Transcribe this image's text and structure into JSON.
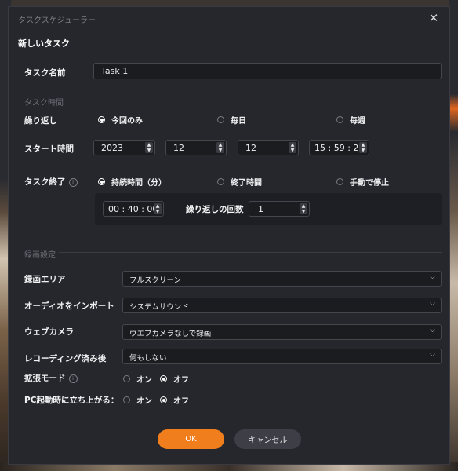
{
  "dialog": {
    "title": "タスクスケジューラー",
    "heading": "新しいタスク",
    "close_icon": "close-icon"
  },
  "task_name": {
    "label": "タスク名前",
    "value": "Task 1"
  },
  "task_time": {
    "section_title": "タスク時間",
    "repeat": {
      "label": "繰り返し",
      "options": [
        "今回のみ",
        "毎日",
        "毎週"
      ],
      "selected": "今回のみ"
    },
    "start": {
      "label": "スタート時間",
      "year": "2023",
      "month": "12",
      "day": "12",
      "time": "15 : 59 : 28"
    },
    "end": {
      "label": "タスク終了",
      "info_icon": "info-icon",
      "options": [
        "持続時間（分）",
        "終了時間",
        "手動で停止"
      ],
      "selected": "持続時間（分）",
      "duration": "00 : 40 : 00",
      "repeat_count_label": "繰り返しの回数",
      "repeat_count": "1"
    }
  },
  "recording": {
    "section_title": "録画設定",
    "area": {
      "label": "録画エリア",
      "value": "フルスクリーン"
    },
    "audio": {
      "label": "オーディオをインポート",
      "value": "システムサウンド"
    },
    "webcam": {
      "label": "ウェブカメラ",
      "value": "ウエブカメラなしで録画"
    },
    "after": {
      "label": "レコーディング済み後",
      "value": "何もしない"
    },
    "extended": {
      "label": "拡張モード",
      "info_icon": "info-icon",
      "on": "オン",
      "off": "オフ",
      "selected": "オフ"
    },
    "startup": {
      "label": "PC起動時に立ち上がる：",
      "on": "オン",
      "off": "オフ",
      "selected": "オフ"
    }
  },
  "buttons": {
    "ok": "OK",
    "cancel": "キャンセル"
  },
  "colors": {
    "accent": "#f07e1c",
    "background": "#26272d",
    "field": "#1b1c20"
  }
}
